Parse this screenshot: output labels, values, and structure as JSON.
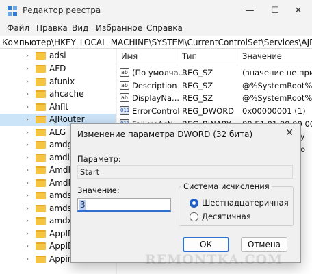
{
  "window": {
    "title": "Редактор реестра",
    "controls": {
      "minimize": "—",
      "maximize": "☐",
      "close": "✕"
    }
  },
  "menu": [
    "Файл",
    "Правка",
    "Вид",
    "Избранное",
    "Справка"
  ],
  "address": "Компьютер\\HKEY_LOCAL_MACHINE\\SYSTEM\\CurrentControlSet\\Services\\AJRouter",
  "tree": {
    "items": [
      {
        "label": "adsi",
        "selected": false
      },
      {
        "label": "AFD",
        "selected": false
      },
      {
        "label": "afunix",
        "selected": false
      },
      {
        "label": "ahcache",
        "selected": false
      },
      {
        "label": "Ahflt",
        "selected": false
      },
      {
        "label": "AJRouter",
        "selected": true
      },
      {
        "label": "ALG",
        "selected": false
      },
      {
        "label": "amdg",
        "selected": false
      },
      {
        "label": "amdi2",
        "selected": false
      },
      {
        "label": "AmdK",
        "selected": false
      },
      {
        "label": "AmdP",
        "selected": false
      },
      {
        "label": "amds",
        "selected": false
      },
      {
        "label": "amdsl",
        "selected": false
      },
      {
        "label": "amdx",
        "selected": false
      },
      {
        "label": "AppID",
        "selected": false
      },
      {
        "label": "AppID",
        "selected": false
      },
      {
        "label": "Appin",
        "selected": false
      }
    ]
  },
  "values": {
    "columns": {
      "name": "Имя",
      "type": "Тип",
      "data": "Значение"
    },
    "rows": [
      {
        "icon": "ab",
        "name": "(По умолча...",
        "type": "REG_SZ",
        "data": "(значение не присв"
      },
      {
        "icon": "ab",
        "name": "Description",
        "type": "REG_SZ",
        "data": "@%SystemRoot%\\sys"
      },
      {
        "icon": "ab",
        "name": "DisplayNa...",
        "type": "REG_SZ",
        "data": "@%SystemRoot%\\sys"
      },
      {
        "icon": "011",
        "name": "ErrorControl",
        "type": "REG_DWORD",
        "data": "0x00000001 (1)"
      },
      {
        "icon": "011",
        "name": "FailureActi...",
        "type": "REG_BINARY",
        "data": "80 51 01 00 00 00 00"
      },
      {
        "icon": "ab",
        "name": "",
        "type": "",
        "data": "%\\sy"
      },
      {
        "icon": "ab",
        "name": "",
        "type": "",
        "data": "%\\Lo"
      }
    ]
  },
  "dialog": {
    "title": "Изменение параметра DWORD (32 бита)",
    "close": "✕",
    "param_label": "Параметр:",
    "param_value": "Start",
    "value_label": "Значение:",
    "value": "3",
    "radix_label": "Система исчисления",
    "radix_hex": "Шестнадцатеричная",
    "radix_dec": "Десятичная",
    "radix_selected": "hex",
    "ok": "ОК",
    "cancel": "Отмена"
  },
  "watermark": "REMONTKA.COM",
  "colors": {
    "selection": "#cce4f7",
    "accent": "#2f6fd0",
    "folder": "#f5c542"
  }
}
